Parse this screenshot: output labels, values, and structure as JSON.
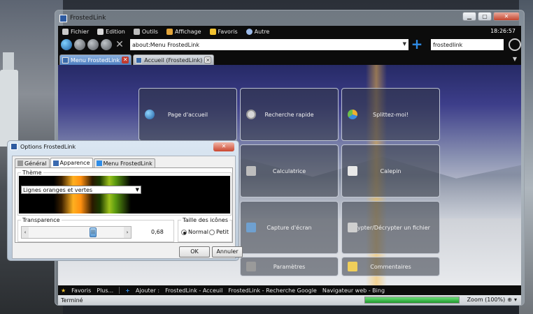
{
  "window": {
    "title": "FrostedLink",
    "clock": "18:26:57"
  },
  "menu": [
    {
      "label": "Fichier",
      "color": "#c9c9c9"
    },
    {
      "label": "Edition",
      "color": "#d9d9d9"
    },
    {
      "label": "Outils",
      "color": "#bdbdbd"
    },
    {
      "label": "Affichage",
      "color": "#e2a43a"
    },
    {
      "label": "Favoris",
      "color": "#f2c230"
    },
    {
      "label": "Autre",
      "color": "#9bb9e8"
    }
  ],
  "nav": {
    "address": "about:Menu FrostedLink",
    "search": "frostedlink"
  },
  "tabs": [
    {
      "label": "Menu FrostedLink",
      "close": "✕"
    },
    {
      "label": "Accueil (FrostedLink)",
      "close": "✕"
    }
  ],
  "tiles": [
    {
      "label": "Page d'accueil",
      "icon": "globe-icon"
    },
    {
      "label": "Recherche rapide",
      "icon": "magnifier-icon"
    },
    {
      "label": "Splittez-moi!",
      "icon": "pie-icon"
    },
    {
      "label": "Calculatrice",
      "icon": "calculator-icon"
    },
    {
      "label": "Calepin",
      "icon": "notepad-icon"
    },
    {
      "label": "Capture d'écran",
      "icon": "screenshot-icon"
    },
    {
      "label": "Crypter/Décrypter un fichier",
      "icon": "lock-icon"
    },
    {
      "label": "Paramètres",
      "icon": "tools-icon"
    },
    {
      "label": "Commentaires",
      "icon": "mail-icon"
    }
  ],
  "favbar": {
    "favorites": "Favoris",
    "more": "Plus...",
    "add": "Ajouter :",
    "links": [
      "FrostedLink - Acceuil",
      "FrostedLink - Recherche Google",
      "Navigateur web - Bing"
    ]
  },
  "status": {
    "text": "Terminé",
    "zoom": "Zoom (100%)",
    "progress": 1.0
  },
  "dialog": {
    "title": "Options FrostedLink",
    "tabs": [
      "Général",
      "Apparence",
      "Menu FrostedLink"
    ],
    "theme_label": "Thème",
    "theme_value": "Lignes oranges et vertes",
    "transparency_label": "Transparence",
    "transparency_value": "0,68",
    "transparency_fraction": 0.68,
    "icon_size_label": "Taille des icônes",
    "size_options": [
      "Normal",
      "Petit"
    ],
    "size_selected": "Normal",
    "ok": "OK",
    "cancel": "Annuler"
  }
}
